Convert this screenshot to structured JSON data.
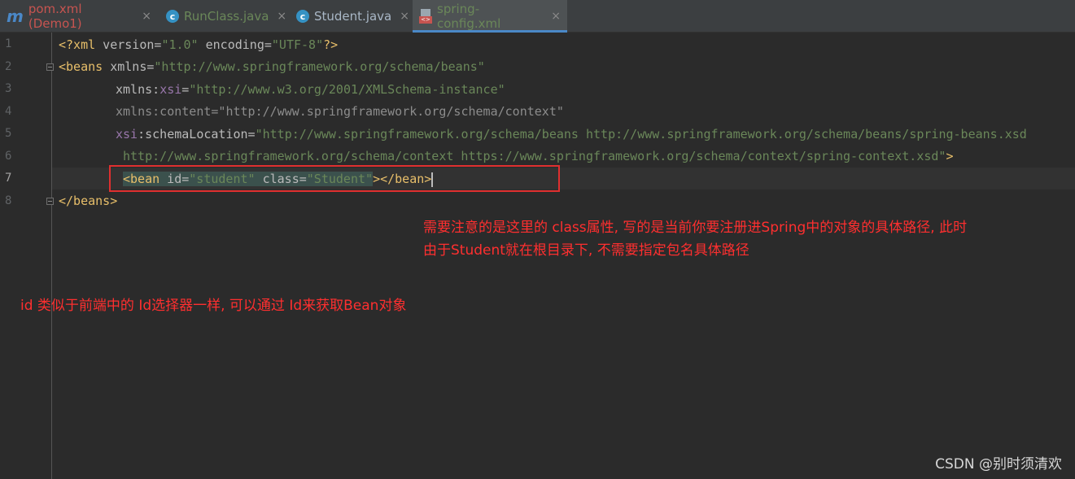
{
  "tabs": [
    {
      "label": "pom.xml (Demo1)",
      "icon": "maven-icon",
      "color": "#c75450",
      "active": false
    },
    {
      "label": "RunClass.java",
      "icon": "java-class-icon",
      "color": "#6a8759",
      "active": false
    },
    {
      "label": "Student.java",
      "icon": "java-class-icon",
      "color": "#a9b7c6",
      "active": false
    },
    {
      "label": "spring-config.xml",
      "icon": "xml-file-icon",
      "color": "#6a8759",
      "active": true
    }
  ],
  "tab_close_glyph": "×",
  "icon_glyphs": {
    "maven": "m",
    "class": "c",
    "xml": "<>"
  },
  "line_numbers": [
    "1",
    "2",
    "3",
    "4",
    "5",
    "6",
    "7",
    "8"
  ],
  "code": {
    "l1": {
      "open": "<?xml",
      "a1": " version=",
      "v1": "\"1.0\"",
      "a2": " encoding=",
      "v2": "\"UTF-8\"",
      "close": "?>"
    },
    "l2": {
      "tag": "<beans",
      "attr": " xmlns=",
      "val": "\"http://www.springframework.org/schema/beans\""
    },
    "l3": {
      "a": "xmlns:",
      "ns": "xsi",
      "eq": "=",
      "val": "\"http://www.w3.org/2001/XMLSchema-instance\""
    },
    "l4": {
      "text": "xmlns:content=\"http://www.springframework.org/schema/context\""
    },
    "l5": {
      "ns": "xsi",
      "a": ":schemaLocation=",
      "val": "\"http://www.springframework.org/schema/beans http://www.springframework.org/schema/beans/spring-beans.xsd"
    },
    "l6": {
      "val": "http://www.springframework.org/schema/context https://www.springframework.org/schema/context/spring-context.xsd\"",
      "close": ">"
    },
    "l7": {
      "tag": "<bean",
      "a1": " id=",
      "v1": "\"student\"",
      "a2": " class=",
      "v2": "\"Student\"",
      "close": "></bean>"
    },
    "l8": {
      "tag": "</beans>"
    }
  },
  "annotations": {
    "class_note_line1": "需要注意的是这里的 class属性, 写的是当前你要注册进Spring中的对象的具体路径, 此时",
    "class_note_line2": "由于Student就在根目录下, 不需要指定包名具体路径",
    "id_note": "id 类似于前端中的 Id选择器一样, 可以通过 Id来获取Bean对象"
  },
  "watermark": "CSDN @别时须清欢"
}
